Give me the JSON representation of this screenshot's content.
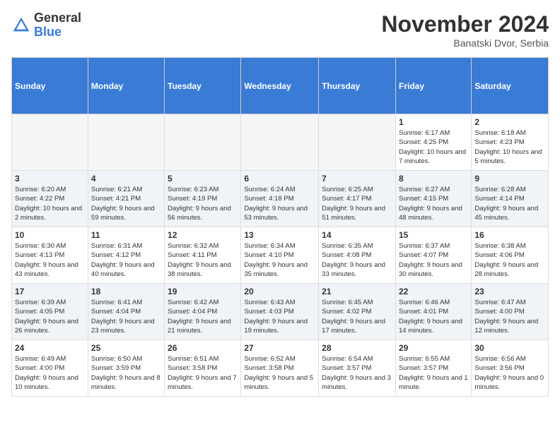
{
  "header": {
    "logo_general": "General",
    "logo_blue": "Blue",
    "month_title": "November 2024",
    "location": "Banatski Dvor, Serbia"
  },
  "weekdays": [
    "Sunday",
    "Monday",
    "Tuesday",
    "Wednesday",
    "Thursday",
    "Friday",
    "Saturday"
  ],
  "weeks": [
    [
      {
        "day": "",
        "info": ""
      },
      {
        "day": "",
        "info": ""
      },
      {
        "day": "",
        "info": ""
      },
      {
        "day": "",
        "info": ""
      },
      {
        "day": "",
        "info": ""
      },
      {
        "day": "1",
        "info": "Sunrise: 6:17 AM\nSunset: 4:25 PM\nDaylight: 10 hours and 7 minutes."
      },
      {
        "day": "2",
        "info": "Sunrise: 6:18 AM\nSunset: 4:23 PM\nDaylight: 10 hours and 5 minutes."
      }
    ],
    [
      {
        "day": "3",
        "info": "Sunrise: 6:20 AM\nSunset: 4:22 PM\nDaylight: 10 hours and 2 minutes."
      },
      {
        "day": "4",
        "info": "Sunrise: 6:21 AM\nSunset: 4:21 PM\nDaylight: 9 hours and 59 minutes."
      },
      {
        "day": "5",
        "info": "Sunrise: 6:23 AM\nSunset: 4:19 PM\nDaylight: 9 hours and 56 minutes."
      },
      {
        "day": "6",
        "info": "Sunrise: 6:24 AM\nSunset: 4:18 PM\nDaylight: 9 hours and 53 minutes."
      },
      {
        "day": "7",
        "info": "Sunrise: 6:25 AM\nSunset: 4:17 PM\nDaylight: 9 hours and 51 minutes."
      },
      {
        "day": "8",
        "info": "Sunrise: 6:27 AM\nSunset: 4:15 PM\nDaylight: 9 hours and 48 minutes."
      },
      {
        "day": "9",
        "info": "Sunrise: 6:28 AM\nSunset: 4:14 PM\nDaylight: 9 hours and 45 minutes."
      }
    ],
    [
      {
        "day": "10",
        "info": "Sunrise: 6:30 AM\nSunset: 4:13 PM\nDaylight: 9 hours and 43 minutes."
      },
      {
        "day": "11",
        "info": "Sunrise: 6:31 AM\nSunset: 4:12 PM\nDaylight: 9 hours and 40 minutes."
      },
      {
        "day": "12",
        "info": "Sunrise: 6:32 AM\nSunset: 4:11 PM\nDaylight: 9 hours and 38 minutes."
      },
      {
        "day": "13",
        "info": "Sunrise: 6:34 AM\nSunset: 4:10 PM\nDaylight: 9 hours and 35 minutes."
      },
      {
        "day": "14",
        "info": "Sunrise: 6:35 AM\nSunset: 4:08 PM\nDaylight: 9 hours and 33 minutes."
      },
      {
        "day": "15",
        "info": "Sunrise: 6:37 AM\nSunset: 4:07 PM\nDaylight: 9 hours and 30 minutes."
      },
      {
        "day": "16",
        "info": "Sunrise: 6:38 AM\nSunset: 4:06 PM\nDaylight: 9 hours and 28 minutes."
      }
    ],
    [
      {
        "day": "17",
        "info": "Sunrise: 6:39 AM\nSunset: 4:05 PM\nDaylight: 9 hours and 26 minutes."
      },
      {
        "day": "18",
        "info": "Sunrise: 6:41 AM\nSunset: 4:04 PM\nDaylight: 9 hours and 23 minutes."
      },
      {
        "day": "19",
        "info": "Sunrise: 6:42 AM\nSunset: 4:04 PM\nDaylight: 9 hours and 21 minutes."
      },
      {
        "day": "20",
        "info": "Sunrise: 6:43 AM\nSunset: 4:03 PM\nDaylight: 9 hours and 19 minutes."
      },
      {
        "day": "21",
        "info": "Sunrise: 6:45 AM\nSunset: 4:02 PM\nDaylight: 9 hours and 17 minutes."
      },
      {
        "day": "22",
        "info": "Sunrise: 6:46 AM\nSunset: 4:01 PM\nDaylight: 9 hours and 14 minutes."
      },
      {
        "day": "23",
        "info": "Sunrise: 6:47 AM\nSunset: 4:00 PM\nDaylight: 9 hours and 12 minutes."
      }
    ],
    [
      {
        "day": "24",
        "info": "Sunrise: 6:49 AM\nSunset: 4:00 PM\nDaylight: 9 hours and 10 minutes."
      },
      {
        "day": "25",
        "info": "Sunrise: 6:50 AM\nSunset: 3:59 PM\nDaylight: 9 hours and 8 minutes."
      },
      {
        "day": "26",
        "info": "Sunrise: 6:51 AM\nSunset: 3:58 PM\nDaylight: 9 hours and 7 minutes."
      },
      {
        "day": "27",
        "info": "Sunrise: 6:52 AM\nSunset: 3:58 PM\nDaylight: 9 hours and 5 minutes."
      },
      {
        "day": "28",
        "info": "Sunrise: 6:54 AM\nSunset: 3:57 PM\nDaylight: 9 hours and 3 minutes."
      },
      {
        "day": "29",
        "info": "Sunrise: 6:55 AM\nSunset: 3:57 PM\nDaylight: 9 hours and 1 minute."
      },
      {
        "day": "30",
        "info": "Sunrise: 6:56 AM\nSunset: 3:56 PM\nDaylight: 9 hours and 0 minutes."
      }
    ]
  ]
}
